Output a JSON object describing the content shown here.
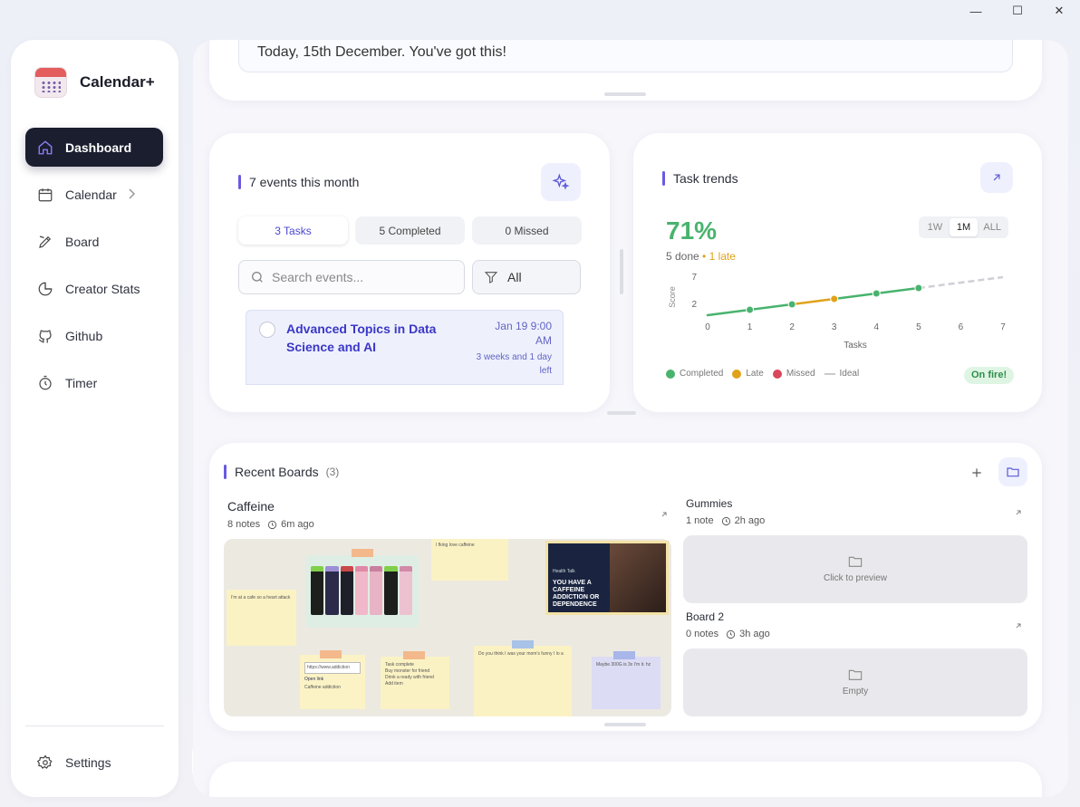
{
  "app": {
    "name": "Calendar+"
  },
  "window": {
    "minimize": "—",
    "maximize": "☐",
    "close": "✕"
  },
  "sidebar": {
    "items": [
      {
        "label": "Dashboard",
        "icon": "home-icon",
        "active": true
      },
      {
        "label": "Calendar",
        "icon": "calendar-icon",
        "has_chevron": true
      },
      {
        "label": "Board",
        "icon": "pen-icon"
      },
      {
        "label": "Creator Stats",
        "icon": "pie-chart-icon"
      },
      {
        "label": "Github",
        "icon": "github-icon"
      },
      {
        "label": "Timer",
        "icon": "timer-icon"
      }
    ],
    "settings": "Settings"
  },
  "greeting": {
    "text": "Today, 15th December. You've got this!"
  },
  "events": {
    "title": "7 events this month",
    "tabs": [
      "3 Tasks",
      "5 Completed",
      "0 Missed"
    ],
    "search_placeholder": "Search events...",
    "filter_label": "All",
    "list": [
      {
        "title": "Advanced Topics in Data Science and AI",
        "date": "Jan 19 9:00 AM",
        "relative": "3 weeks and 1 day left"
      }
    ]
  },
  "trends": {
    "title": "Task trends",
    "percent": "71%",
    "done": "5 done",
    "late": "• 1 late",
    "range": [
      "1W",
      "1M",
      "ALL"
    ],
    "range_selected": "1M",
    "badge": "On fire!",
    "legend": [
      "Completed",
      "Late",
      "Missed",
      "Ideal"
    ],
    "colors": {
      "completed": "#49b36e",
      "late": "#e0a21a",
      "missed": "#d9475a",
      "ideal": "#c9c9cf"
    }
  },
  "chart_data": {
    "type": "line",
    "xlabel": "Tasks",
    "ylabel": "Score",
    "x_ticks": [
      0,
      1,
      2,
      3,
      4,
      5,
      6,
      7
    ],
    "y_ticks": [
      2,
      7
    ],
    "series": [
      {
        "name": "Completed",
        "points": [
          [
            0,
            0
          ],
          [
            1,
            1
          ],
          [
            2,
            2
          ],
          [
            3,
            3
          ],
          [
            4,
            4
          ],
          [
            5,
            5
          ]
        ]
      },
      {
        "name": "Ideal",
        "points": [
          [
            5,
            5
          ],
          [
            6,
            6
          ],
          [
            7,
            7
          ]
        ]
      }
    ],
    "late_segment": [
      2,
      3
    ],
    "markers": [
      {
        "x": 1,
        "y": 1,
        "status": "Completed"
      },
      {
        "x": 2,
        "y": 2,
        "status": "Completed"
      },
      {
        "x": 3,
        "y": 3,
        "status": "Late"
      },
      {
        "x": 4,
        "y": 4,
        "status": "Completed"
      },
      {
        "x": 5,
        "y": 5,
        "status": "Completed"
      }
    ]
  },
  "boards": {
    "title": "Recent Boards",
    "count": "(3)",
    "items": [
      {
        "name": "Caffeine",
        "notes": "8 notes",
        "time": "6m ago"
      },
      {
        "name": "Gummies",
        "notes": "1 note",
        "time": "2h ago",
        "preview": "Click to preview"
      },
      {
        "name": "Board 2",
        "notes": "0 notes",
        "time": "3h ago",
        "preview": "Empty"
      }
    ],
    "caffeine_preview": {
      "notes": [
        "I'm at a cafe so a heart attack",
        "I fking love caffeine",
        "Do you think I was your mom's funny I lo a",
        "Maybe 300G is 3x I'm it. hz"
      ],
      "link_note": {
        "url": "https://www.addiction",
        "label1": "Open link",
        "label2": "Caffeine addiction"
      },
      "todo": [
        "Task complete",
        "Buy monster for friend",
        "Drink a ready with friend",
        "Add item"
      ],
      "photo_caption": "YOU HAVE A CAFFEINE ADDICTION OR DEPENDENCE",
      "photo_small": "Health Talk"
    }
  }
}
